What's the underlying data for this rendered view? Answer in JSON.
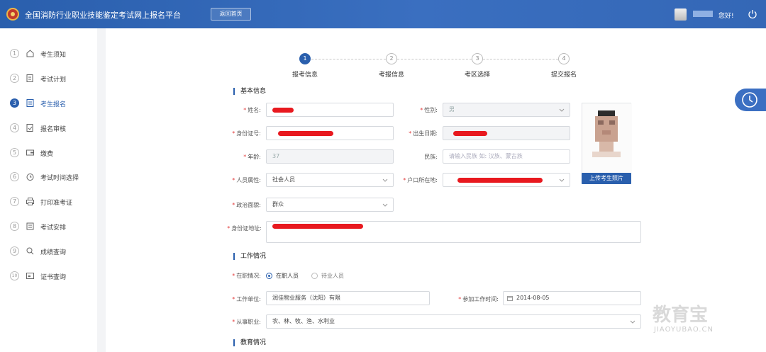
{
  "header": {
    "title": "全国消防行业职业技能鉴定考试网上报名平台",
    "home_button": "返回首页",
    "greeting": "您好!"
  },
  "sidebar": {
    "items": [
      {
        "num": "1",
        "label": "考生须知"
      },
      {
        "num": "2",
        "label": "考试计划"
      },
      {
        "num": "3",
        "label": "考生报名"
      },
      {
        "num": "4",
        "label": "报名审核"
      },
      {
        "num": "5",
        "label": "缴费"
      },
      {
        "num": "6",
        "label": "考试时间选择"
      },
      {
        "num": "7",
        "label": "打印准考证"
      },
      {
        "num": "8",
        "label": "考试安排"
      },
      {
        "num": "9",
        "label": "成绩查询"
      },
      {
        "num": "10",
        "label": "证书查询"
      }
    ]
  },
  "steps": [
    {
      "num": "1",
      "label": "报考信息"
    },
    {
      "num": "2",
      "label": "考报信息"
    },
    {
      "num": "3",
      "label": "考区选择"
    },
    {
      "num": "4",
      "label": "提交报名"
    }
  ],
  "sections": {
    "basic": "基本信息",
    "work": "工作情况",
    "education": "教育情况"
  },
  "form": {
    "name_label": "姓名:",
    "gender_label": "性别:",
    "gender_value": "男",
    "id_label": "身份证号:",
    "birth_label": "出生日期:",
    "age_label": "年龄:",
    "age_value": "37",
    "ethnicity_label": "民族:",
    "ethnicity_placeholder": "请输入民族 如: 汉族、蒙古族",
    "person_type_label": "人员属性:",
    "person_type_value": "社会人员",
    "hukou_label": "户口所在地:",
    "politics_label": "政治面貌:",
    "politics_value": "群众",
    "address_label": "身份证地址:",
    "employment_label": "在职情况:",
    "employment_options": [
      "在职人员",
      "待业人员"
    ],
    "employer_label": "工作单位:",
    "employer_value": "润佳物业服务（沈阳）有限",
    "work_start_label": "参加工作时间:",
    "work_start_value": "2014-08-05",
    "occupation_label": "从事职业:",
    "occupation_value": "农、林、牧、渔、水利业"
  },
  "photo": {
    "upload_button": "上传考生照片"
  },
  "watermark": {
    "logo": "教育宝",
    "url": "JIAOYUBAO.CN"
  }
}
